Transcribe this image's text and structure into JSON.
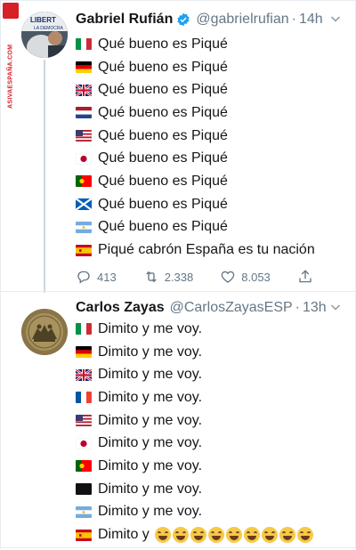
{
  "watermark": {
    "text": "ASIVAESPAÑA.COM"
  },
  "tweet1": {
    "display_name": "Gabriel Rufián",
    "handle": "@gabrielrufian",
    "separator": "·",
    "time": "14h",
    "avatar_text": "LIBERT",
    "avatar_subtext": "LA DEMOCRA",
    "lines": [
      {
        "flag": "it",
        "text": "Qué bueno es Piqué"
      },
      {
        "flag": "de",
        "text": "Qué bueno es Piqué"
      },
      {
        "flag": "gb",
        "text": "Qué bueno es Piqué"
      },
      {
        "flag": "nl",
        "text": "Qué bueno es Piqué"
      },
      {
        "flag": "us",
        "text": "Qué bueno es Piqué"
      },
      {
        "flag": "jp",
        "text": "Qué bueno es Piqué"
      },
      {
        "flag": "pt",
        "text": "Qué bueno es Piqué"
      },
      {
        "flag": "sc",
        "text": "Qué bueno es Piqué"
      },
      {
        "flag": "ar",
        "text": "Qué bueno es Piqué"
      },
      {
        "flag": "es",
        "text": "Piqué cabrón España es tu nación"
      }
    ],
    "replies": "413",
    "retweets": "2.338",
    "likes": "8.053"
  },
  "tweet2": {
    "display_name": "Carlos Zayas",
    "handle": "@CarlosZayasESP",
    "separator": "·",
    "time": "13h",
    "lines": [
      {
        "flag": "it",
        "text": "Dimito y me voy."
      },
      {
        "flag": "de",
        "text": "Dimito y me voy."
      },
      {
        "flag": "gb",
        "text": "Dimito y me voy."
      },
      {
        "flag": "fr",
        "text": "Dimito y me voy."
      },
      {
        "flag": "us",
        "text": "Dimito y me voy."
      },
      {
        "flag": "jp",
        "text": "Dimito y me voy."
      },
      {
        "flag": "pt",
        "text": "Dimito y me voy."
      },
      {
        "flag": "black",
        "text": "Dimito y me voy."
      },
      {
        "flag": "ar",
        "text": "Dimito y me voy."
      },
      {
        "flag": "es",
        "text": "Dimito y",
        "emoji_count": 9
      }
    ]
  },
  "colors": {
    "text": "#14171a",
    "muted": "#657786",
    "verified": "#1da1f2",
    "divider": "#e6ecf0",
    "watermark": "#d61f26"
  }
}
